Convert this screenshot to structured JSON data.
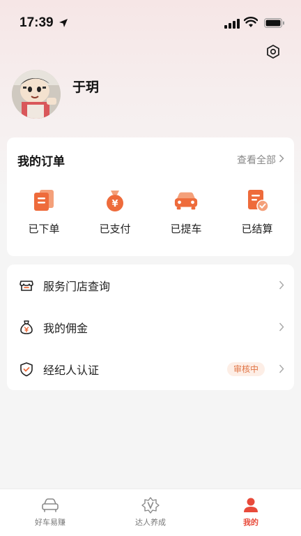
{
  "status_bar": {
    "time": "17:39"
  },
  "profile": {
    "name": "于玥"
  },
  "orders": {
    "title": "我的订单",
    "view_all": "查看全部",
    "items": [
      {
        "label": "已下单",
        "icon": "order-placed-icon"
      },
      {
        "label": "已支付",
        "icon": "paid-money-bag-icon"
      },
      {
        "label": "已提车",
        "icon": "car-icon"
      },
      {
        "label": "已结算",
        "icon": "settled-document-icon"
      }
    ]
  },
  "menu": [
    {
      "label": "服务门店查询",
      "icon": "store-icon"
    },
    {
      "label": "我的佣金",
      "icon": "money-bag-icon"
    },
    {
      "label": "经纪人认证",
      "icon": "shield-check-icon",
      "badge": "审核中"
    }
  ],
  "tabs": [
    {
      "label": "好车易赚",
      "icon": "car-outline-icon",
      "active": false
    },
    {
      "label": "达人养成",
      "icon": "star-badge-icon",
      "active": false
    },
    {
      "label": "我的",
      "icon": "person-icon",
      "active": true
    }
  ],
  "colors": {
    "accent": "#e84a3a",
    "icon_orange": "#ef6b3b",
    "badge_bg": "#fdeee6",
    "badge_text": "#e07444"
  }
}
